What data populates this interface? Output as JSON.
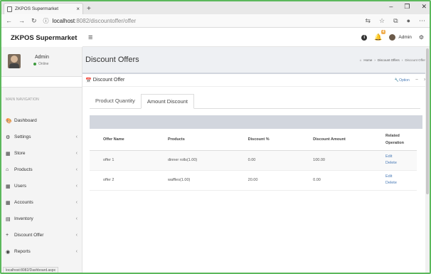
{
  "browser": {
    "tab_title": "ZKPOS Supermarket",
    "url_host": "localhost",
    "url_path": ":8082/discountoffer/offer",
    "status_url": "localhost:8082/Dashboard.aspx"
  },
  "app": {
    "logo": "ZKPOS Supermarket",
    "notification_count": "4",
    "nav_user": "Admin"
  },
  "sidebar": {
    "user_name": "Admin",
    "user_status": "Online",
    "section_header": "MAIN NAVIGATION",
    "items": [
      {
        "label": "Dashboard",
        "icon": "dashboard-icon"
      },
      {
        "label": "Settings",
        "icon": "gear-icon"
      },
      {
        "label": "Store",
        "icon": "store-icon"
      },
      {
        "label": "Products",
        "icon": "tag-icon"
      },
      {
        "label": "Users",
        "icon": "users-icon"
      },
      {
        "label": "Accounts",
        "icon": "accounts-icon"
      },
      {
        "label": "Inventory",
        "icon": "inventory-icon"
      },
      {
        "label": "Discount Offer",
        "icon": "plus-icon"
      },
      {
        "label": "Reports",
        "icon": "eye-icon"
      }
    ]
  },
  "content": {
    "page_title": "Discount Offers",
    "breadcrumb": [
      "Home",
      "Discount Offers",
      "Discount Offer"
    ],
    "box_title": "Discount Offer",
    "box_options": "Option",
    "tabs": [
      "Product Quantity",
      "Amount Discount"
    ],
    "active_tab": "Amount Discount",
    "table": {
      "headers": [
        "Offer Name",
        "Products",
        "Discount %",
        "Discount Amount",
        "Related Operation"
      ],
      "rows": [
        {
          "offer": "offer 1",
          "products": "dinner rolls(1.00)",
          "pct": "0.00",
          "amount": "100.00",
          "edit": "Edit",
          "delete": "Delete"
        },
        {
          "offer": "offer 2",
          "products": "waffles(1.00)",
          "pct": "20.00",
          "amount": "0.00",
          "edit": "Edit",
          "delete": "Delete"
        }
      ]
    }
  },
  "colors": {
    "frame_border": "#5cb85c",
    "link": "#4a7bb7",
    "online": "#3c9a3c",
    "badge": "#f0ad4e"
  }
}
